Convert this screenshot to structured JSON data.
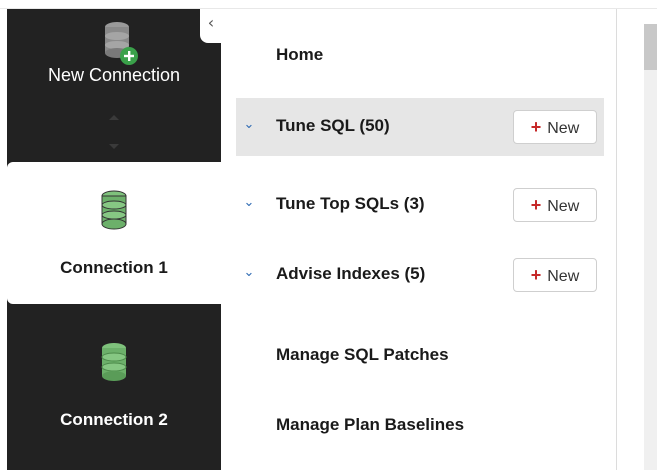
{
  "rail": {
    "new_connection_label": "New Connection",
    "connections": [
      {
        "label": "Connection 1",
        "active": true
      },
      {
        "label": "Connection 2",
        "active": false
      }
    ]
  },
  "collapse_glyph": "‹",
  "menu": {
    "home_label": "Home",
    "items": [
      {
        "label": "Tune SQL (50)",
        "new_label": "New"
      },
      {
        "label": "Tune Top SQLs (3)",
        "new_label": "New"
      },
      {
        "label": "Advise Indexes (5)",
        "new_label": "New"
      }
    ],
    "manage_patches_label": "Manage SQL Patches",
    "manage_baselines_label": "Manage Plan Baselines"
  },
  "colors": {
    "rail_bg": "#222222",
    "accent_blue": "#2f6bb3",
    "plus_red": "#c62828",
    "db_green": "#6cb06a",
    "add_badge_green": "#3aa14a"
  },
  "icons": {
    "new_connection": "database-add-icon",
    "connection": "database-icon",
    "expand": "chevron-down-icon",
    "collapse": "chevron-left-icon",
    "plus": "plus-icon"
  }
}
